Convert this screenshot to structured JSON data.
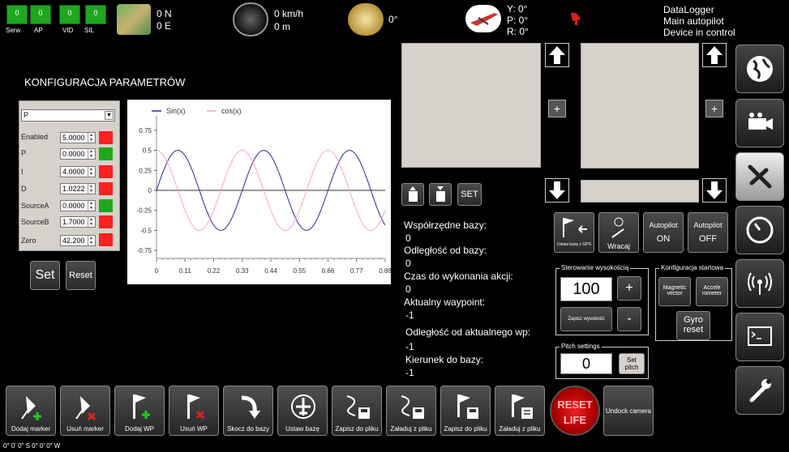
{
  "status_leds": [
    {
      "label": "Serw",
      "value": "0"
    },
    {
      "label": "AP",
      "value": "0"
    },
    {
      "label": "VID",
      "value": "0"
    },
    {
      "label": "SIL",
      "value": "0"
    }
  ],
  "gps": {
    "lat": "0 N",
    "lon": "0 E"
  },
  "speed": {
    "kmh": "0 km/h",
    "alt": "0 m"
  },
  "heading": {
    "value": "0°"
  },
  "attitude": {
    "y": "Y: 0°",
    "p": "P: 0°",
    "r": "R: 0°"
  },
  "device": {
    "line1": "DataLogger",
    "line2": "Main autopilot",
    "line3": "Device in control"
  },
  "config": {
    "title": "KONFIGURACJA PARAMETRÓW",
    "selected": "P",
    "rows": [
      {
        "label": "Enabled",
        "value": "5.0000",
        "color": "#ff2020"
      },
      {
        "label": "P",
        "value": "0.0000",
        "color": "#1fa81f"
      },
      {
        "label": "I",
        "value": "4.0000",
        "color": "#ff2020"
      },
      {
        "label": "D",
        "value": "1.0222",
        "color": "#ff2020"
      },
      {
        "label": "SourceA",
        "value": "0.0000",
        "color": "#1fa81f"
      },
      {
        "label": "SourceB",
        "value": "1.7000",
        "color": "#ff2020"
      },
      {
        "label": "Zero",
        "value": "42.200",
        "color": "#ff2020"
      }
    ],
    "set_label": "Set",
    "reset_label": "Reset"
  },
  "chart_data": {
    "type": "line",
    "legend": [
      "Sin(x)",
      "cos(x)"
    ],
    "legend_placement": "top-left",
    "x_ticks": [
      "0",
      "0.11",
      "0.22",
      "0.33",
      "0.44",
      "0.55",
      "0.66",
      "0.77",
      "0.88"
    ],
    "y_ticks": [
      "0.75",
      "0.5",
      "0.25",
      "0",
      "-0.25",
      "-0.5",
      "-0.75"
    ],
    "xlim": [
      0,
      0.88
    ],
    "ylim": [
      -0.85,
      0.85
    ],
    "series": [
      {
        "name": "Sin(x)",
        "color": "#2a2aa8",
        "amplitude": 0.5,
        "period": 0.33,
        "phase": "sin"
      },
      {
        "name": "cos(x)",
        "color": "#f2aac2",
        "amplitude": 0.5,
        "period": 0.33,
        "phase": "cos"
      }
    ]
  },
  "mid_tools": {
    "set_label": "SET"
  },
  "info": {
    "base_coords_label": "Współrzędne bazy:",
    "base_coords_value": "0",
    "base_dist_label": "Odległość od bazy:",
    "base_dist_value": "0",
    "action_time_label": "Czas do wykonania akcji:",
    "action_time_value": "0",
    "waypoint_label": "Aktualny waypoint:",
    "waypoint_value": "-1",
    "wp_dist_label": "Odległość od aktualnego wp:",
    "wp_dist_value": "-1",
    "base_dir_label": "Kierunek do bazy:",
    "base_dir_value": "-1"
  },
  "controls": {
    "set_base_label": "Ustaw bazę z GPS",
    "return_label": "Wracaj",
    "autopilot_on_top": "Autopilot",
    "autopilot_on_bot": "ON",
    "autopilot_off_top": "Autopilot",
    "autopilot_off_bot": "OFF"
  },
  "altitude": {
    "title": "Sterowanie wysokością",
    "value": "100",
    "plus": "+",
    "minus": "-",
    "save_label": "Zapisz wysokość"
  },
  "startup": {
    "title": "Konfiguracja startowa",
    "magnetic_label": "Magnetic vector",
    "accel_label": "Accele rometer",
    "gyro_label": "Gyro reset"
  },
  "pitch": {
    "title": "Pitch settings",
    "value": "0",
    "set_label": "Set pitch"
  },
  "bottom_buttons": [
    {
      "label": "Dodaj marker"
    },
    {
      "label": "Usuń marker"
    },
    {
      "label": "Dodaj WP"
    },
    {
      "label": "Usuń WP"
    },
    {
      "label": "Skocz do bazy"
    },
    {
      "label": "Ustaw bazę"
    },
    {
      "label": "Zapisz do pliku"
    },
    {
      "label": "Załaduj z pliku"
    },
    {
      "label": "Zapisz do pliku"
    },
    {
      "label": "Załaduj z pliku"
    }
  ],
  "reset_life": {
    "line1": "RESET",
    "line2": "LIFE"
  },
  "undock_label": "Undock camera",
  "coords_footer": "0° 0' 0\" S  0° 0' 0\" W",
  "colors": {
    "green": "#1fa81f",
    "red": "#ff2020",
    "panel": "#d6d2cb"
  }
}
